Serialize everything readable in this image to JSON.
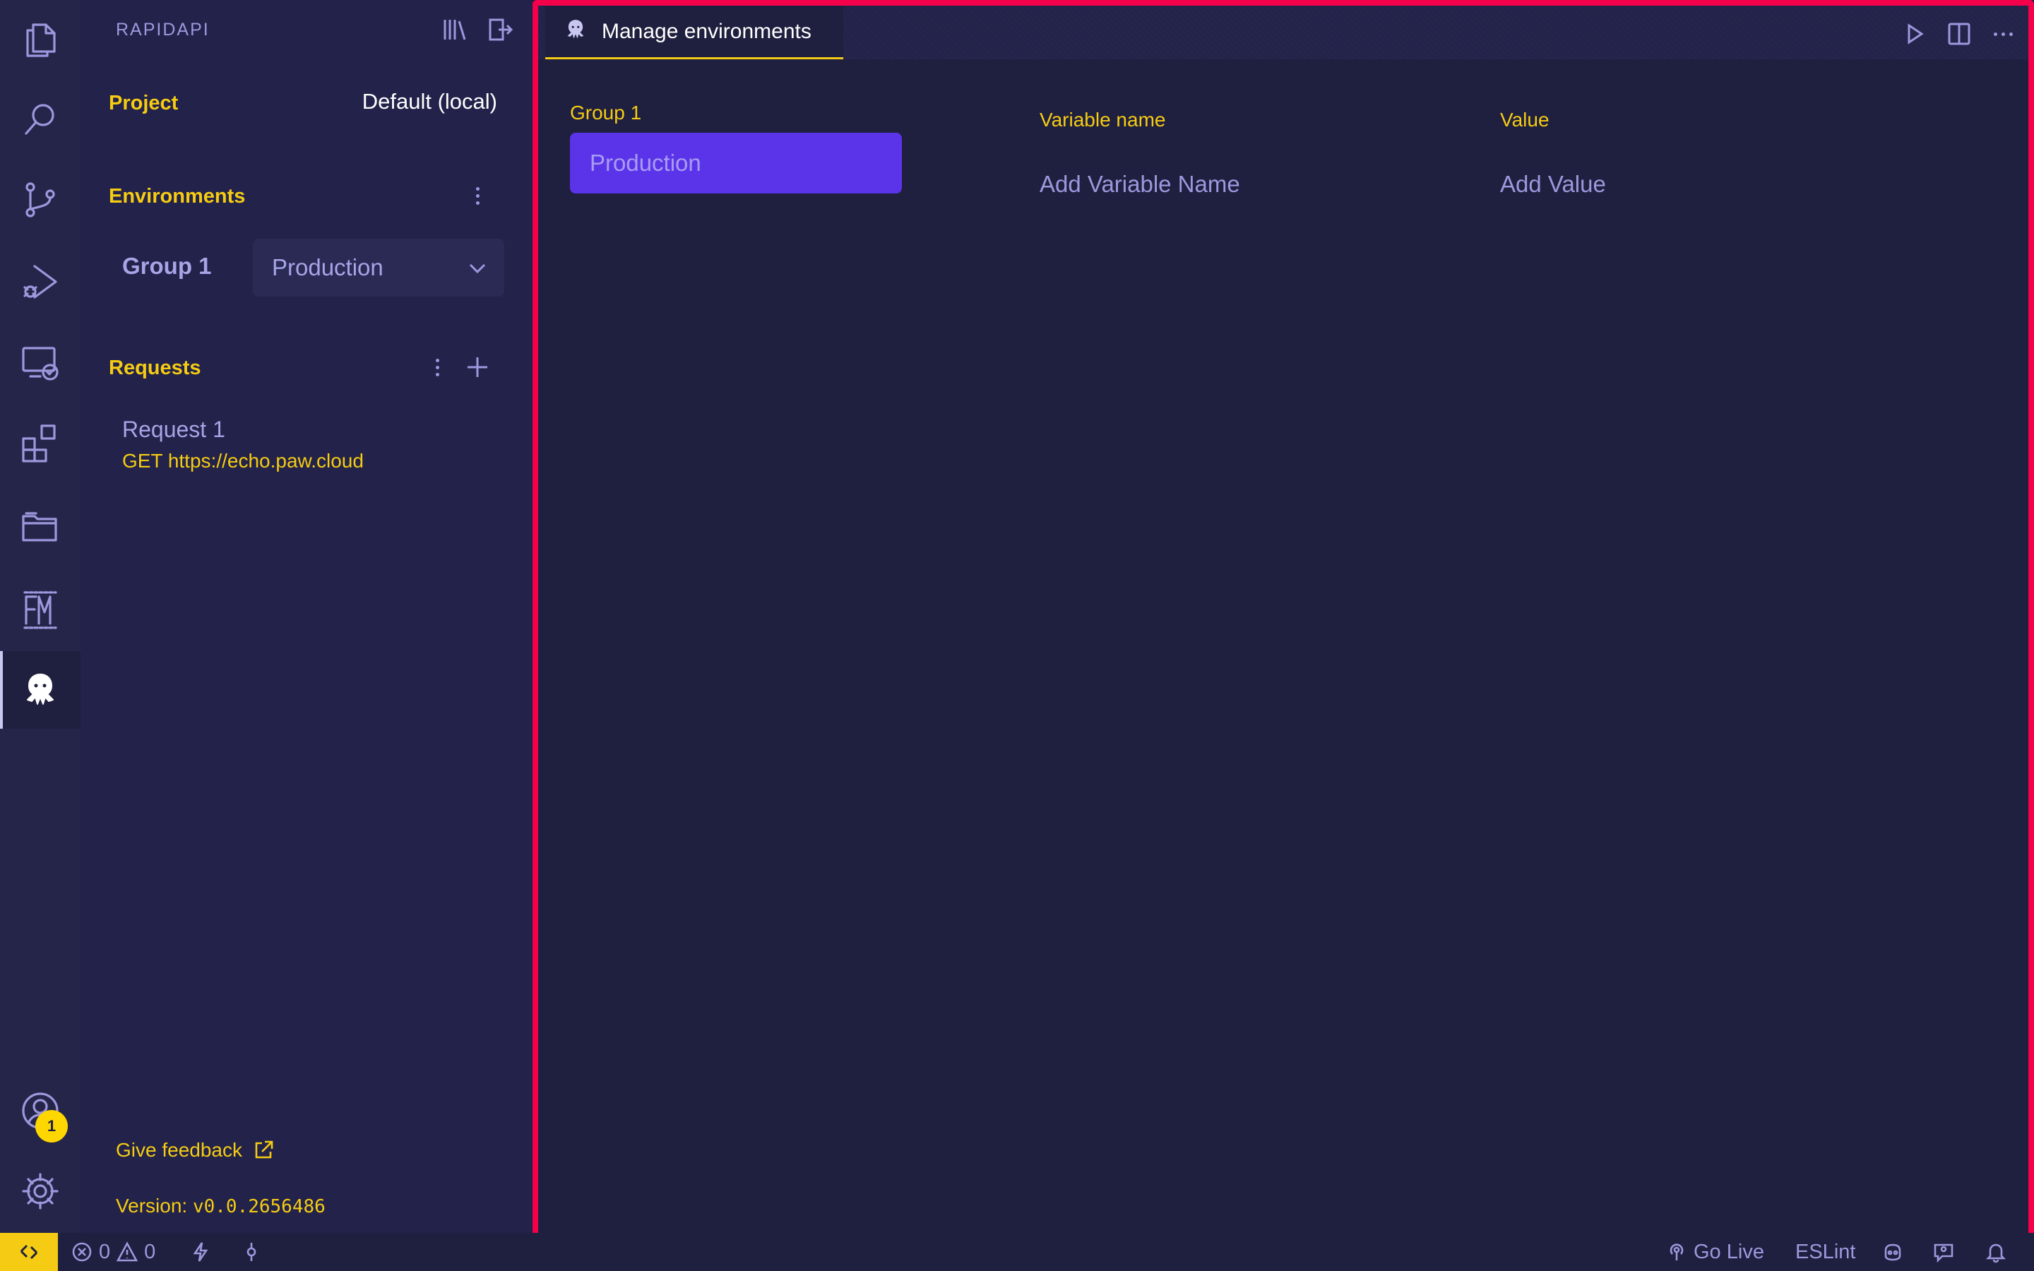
{
  "sidebar": {
    "title": "RAPIDAPI",
    "project_label": "Project",
    "project_value": "Default (local)",
    "environments_label": "Environments",
    "group_label": "Group 1",
    "environment_selected": "Production",
    "requests_label": "Requests",
    "requests": [
      {
        "name": "Request 1",
        "url": "GET https://echo.paw.cloud"
      }
    ],
    "feedback_label": "Give feedback",
    "version_prefix": "Version: ",
    "version_value": "v0.0.2656486"
  },
  "editor": {
    "tab_label": "Manage environments",
    "group_label": "Group 1",
    "environment_chip": "Production",
    "variable_name_header": "Variable name",
    "value_header": "Value",
    "variable_name_placeholder": "Add Variable Name",
    "value_placeholder": "Add Value"
  },
  "activity_bar": {
    "items": [
      "explorer-icon",
      "search-icon",
      "source-control-icon",
      "run-debug-icon",
      "remote-explorer-icon",
      "extensions-icon",
      "project-manager-icon",
      "fm-icon",
      "rapidapi-icon",
      "accounts-icon",
      "settings-icon"
    ],
    "accounts_badge": "1"
  },
  "statusbar": {
    "errors": "0",
    "warnings": "0",
    "go_live": "Go Live",
    "eslint": "ESLint"
  },
  "colors": {
    "accent_yellow": "#f5cc13",
    "chip_purple": "#5b34ea",
    "frame_red": "#f5004a",
    "background": "#1f1f3f"
  }
}
